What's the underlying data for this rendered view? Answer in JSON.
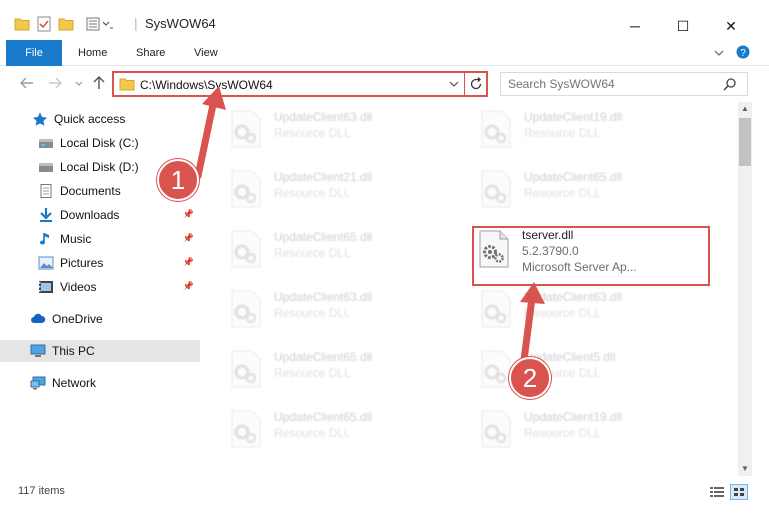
{
  "window": {
    "title": "SysWOW64",
    "controls": {
      "minimize": "─",
      "maximize": "☐",
      "close": "✕"
    }
  },
  "ribbon": {
    "tabs": [
      "File",
      "Home",
      "Share",
      "View"
    ]
  },
  "address": {
    "path": "C:\\Windows\\SysWOW64",
    "search_placeholder": "Search SysWOW64"
  },
  "sidebar": {
    "items": [
      {
        "label": "Quick access",
        "icon": "star-icon",
        "pinned": false
      },
      {
        "label": "Local Disk (C:)",
        "icon": "drive-icon",
        "pinned": false
      },
      {
        "label": "Local Disk (D:)",
        "icon": "drive-icon",
        "pinned": false
      },
      {
        "label": "Documents",
        "icon": "documents-icon",
        "pinned": false
      },
      {
        "label": "Downloads",
        "icon": "download-icon",
        "pinned": true
      },
      {
        "label": "Music",
        "icon": "music-icon",
        "pinned": true
      },
      {
        "label": "Pictures",
        "icon": "pictures-icon",
        "pinned": true
      },
      {
        "label": "Videos",
        "icon": "videos-icon",
        "pinned": true
      },
      {
        "label": "OneDrive",
        "icon": "cloud-icon",
        "pinned": false
      },
      {
        "label": "This PC",
        "icon": "computer-icon",
        "pinned": false
      },
      {
        "label": "Network",
        "icon": "network-icon",
        "pinned": false
      }
    ],
    "pin_glyph": "📌"
  },
  "files": {
    "faded_type": "Resource DLL",
    "left_column": [
      "UpdateClient63.dll",
      "UpdateClient21.dll",
      "UpdateClient65.dll",
      "UpdateClient63.dll",
      "UpdateClient65.dll",
      "UpdateClient65.dll"
    ],
    "right_column": [
      "UpdateClient19.dll",
      "UpdateClient65.dll",
      "",
      "UpdateClient63.dll",
      "UpdateClient5.dll",
      "UpdateClient19.dll"
    ],
    "highlighted": {
      "name": "tserver.dll",
      "version": "5.2.3790.0",
      "description": "Microsoft Server Ap..."
    }
  },
  "status": {
    "item_count": "117 items"
  },
  "annotations": {
    "step1": "1",
    "step2": "2",
    "color": "#d9534f"
  }
}
